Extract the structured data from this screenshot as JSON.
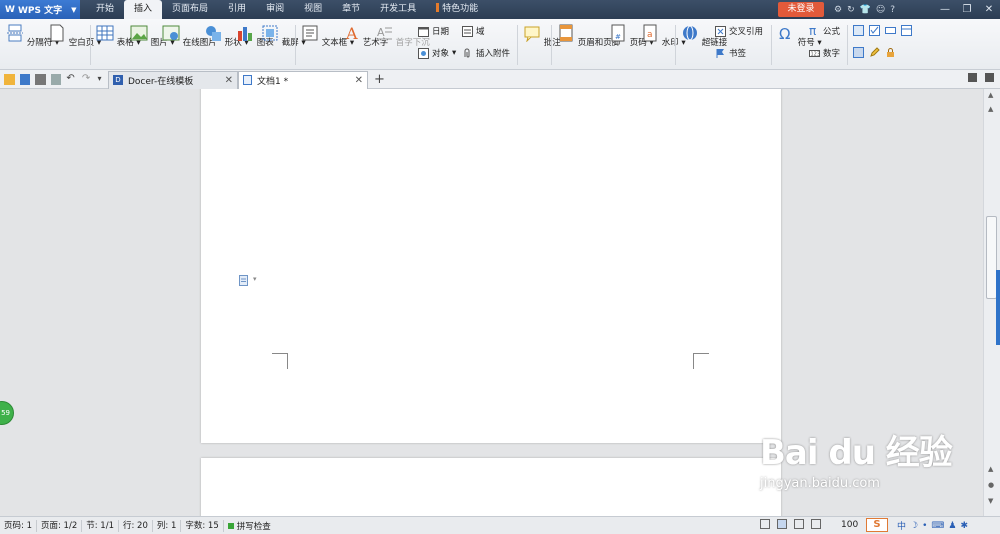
{
  "app": {
    "title": "WPS 文字"
  },
  "menu": {
    "tabs": [
      {
        "label": "开始"
      },
      {
        "label": "插入"
      },
      {
        "label": "页面布局"
      },
      {
        "label": "引用"
      },
      {
        "label": "审阅"
      },
      {
        "label": "视图"
      },
      {
        "label": "章节"
      },
      {
        "label": "开发工具"
      },
      {
        "label": "特色功能"
      }
    ],
    "active_tab": "插入",
    "login_label": "未登录",
    "help_label": "?"
  },
  "ribbon": {
    "section_break": "分隔符",
    "blank_page": "空白页",
    "table": "表格",
    "picture": "图片",
    "online_picture": "在线图片",
    "shape": "形状",
    "chart": "图表",
    "screenshot": "截屏",
    "textbox": "文本框",
    "wordart": "艺术字",
    "dropcap": "首字下沉",
    "date": "日期",
    "object": "对象",
    "field": "域",
    "attachment": "插入附件",
    "comment": "批注",
    "header_footer": "页眉和页脚",
    "page_number": "页码",
    "watermark": "水印",
    "hyperlink": "超链接",
    "cross_ref": "交叉引用",
    "bookmark": "书签",
    "symbol": "符号",
    "formula": "公式",
    "number": "数字"
  },
  "tabs": [
    {
      "label": "Docer-在线模板",
      "active": false
    },
    {
      "label": "文档1 *",
      "active": true
    }
  ],
  "workspace": {
    "side_bubble": "59"
  },
  "status": {
    "page": "页码: 1",
    "pages": "页面: 1/2",
    "section": "节: 1/1",
    "row": "行: 20",
    "col": "列: 1",
    "words": "字数: 15",
    "spell": "拼写检查",
    "zoom": "100",
    "ime_logo": "S",
    "ime_label": "中"
  },
  "watermark_text": {
    "main": "Bai du 经验",
    "sub": "jingyan.baidu.com"
  },
  "colors": {
    "accent": "#2f73c9",
    "login": "#e25a3a",
    "menubar": "#34465d"
  }
}
